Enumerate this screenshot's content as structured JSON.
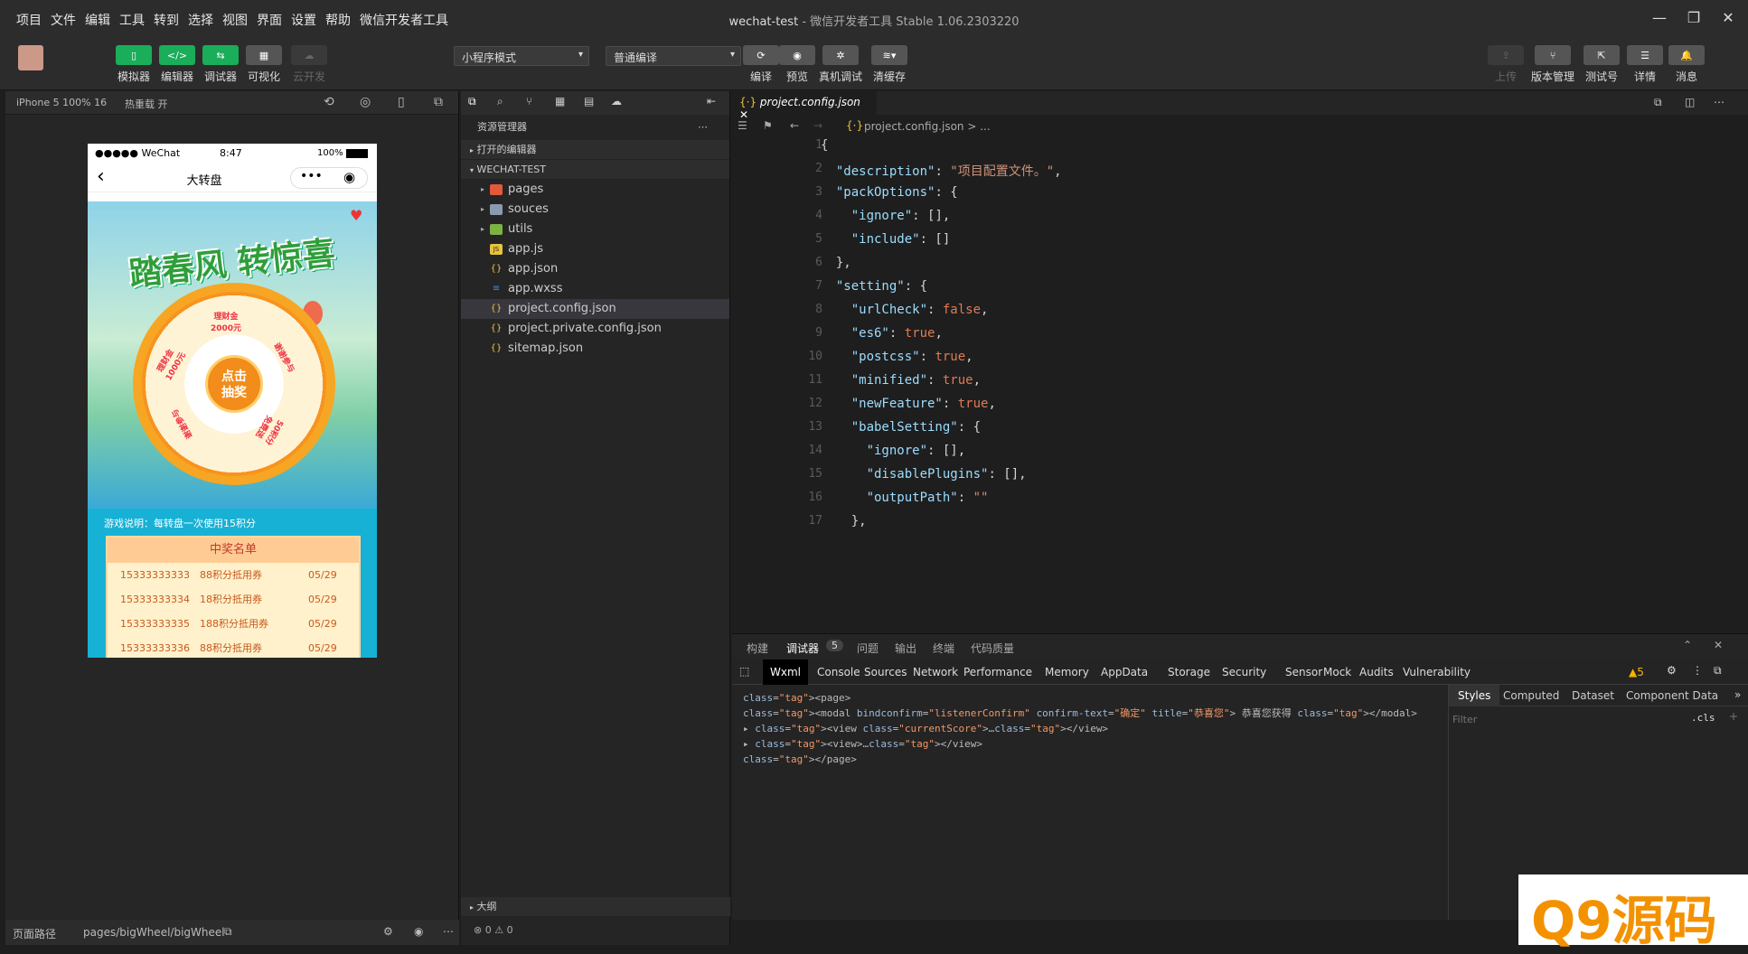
{
  "menubar": {
    "items": [
      "项目",
      "文件",
      "编辑",
      "工具",
      "转到",
      "选择",
      "视图",
      "界面",
      "设置",
      "帮助",
      "微信开发者工具"
    ],
    "title_main": "wechat-test",
    "title_sub": " - 微信开发者工具 Stable 1.06.2303220"
  },
  "toolbar": {
    "simulator": "模拟器",
    "editor": "编辑器",
    "debugger": "调试器",
    "visual": "可视化",
    "cloud": "云开发",
    "mode_select": "小程序模式",
    "compile_select": "普通编译",
    "compile": "编译",
    "preview": "预览",
    "realdebug": "真机调试",
    "clearcache": "清缓存",
    "upload": "上传",
    "version": "版本管理",
    "testaccount": "测试号",
    "details": "详情",
    "messages": "消息"
  },
  "simulator": {
    "device": "iPhone 5 100% 16",
    "hotreload": "热重载 开",
    "statusbar_left": "●●●●● WeChat",
    "statusbar_time": "8:47",
    "statusbar_battery": "100%",
    "nav_title": "大转盘",
    "banner_title": "踏春风 转惊喜",
    "wheel_center": "点击\n抽奖",
    "segment_1": "理财金\n2000元",
    "segment_2": "谢谢参与",
    "segment_3": "50积分\n免费送",
    "segment_4": "谢谢参与",
    "segment_5": "理财金\n1000元",
    "rule_text": "游戏说明：每转盘一次使用15积分",
    "winners_title": "中奖名单",
    "winners": [
      {
        "phone": "15333333333",
        "prize": "88积分抵用券",
        "date": "05/29"
      },
      {
        "phone": "15333333334",
        "prize": "18积分抵用券",
        "date": "05/29"
      },
      {
        "phone": "15333333335",
        "prize": "188积分抵用券",
        "date": "05/29"
      },
      {
        "phone": "15333333336",
        "prize": "88积分抵用券",
        "date": "05/29"
      }
    ],
    "footer_path_label": "页面路径",
    "footer_path": "pages/bigWheel/bigWheel"
  },
  "explorer": {
    "title": "资源管理器",
    "open_editors": "打开的编辑器",
    "project": "WECHAT-TEST",
    "files": [
      {
        "name": "pages",
        "type": "folder",
        "color": "#e2593b"
      },
      {
        "name": "souces",
        "type": "folder",
        "color": "#8a9bb0"
      },
      {
        "name": "utils",
        "type": "folder",
        "color": "#7cb342"
      },
      {
        "name": "app.js",
        "type": "js",
        "color": "#e8c33b"
      },
      {
        "name": "app.json",
        "type": "json",
        "color": "#e8c33b"
      },
      {
        "name": "app.wxss",
        "type": "wxss",
        "color": "#3b8fe8"
      },
      {
        "name": "project.config.json",
        "type": "json",
        "color": "#e8c33b"
      },
      {
        "name": "project.private.config.json",
        "type": "json",
        "color": "#e8c33b"
      },
      {
        "name": "sitemap.json",
        "type": "json",
        "color": "#e8c33b"
      }
    ],
    "outline": "大纲",
    "status": "⊗ 0 ⚠ 0"
  },
  "editor": {
    "tab": "project.config.json",
    "breadcrumb": "project.config.json > ...",
    "lines": [
      "{",
      "  \"description\": \"项目配置文件。\",",
      "  \"packOptions\": {",
      "    \"ignore\": [],",
      "    \"include\": []",
      "  },",
      "  \"setting\": {",
      "    \"urlCheck\": false,",
      "    \"es6\": true,",
      "    \"postcss\": true,",
      "    \"minified\": true,",
      "    \"newFeature\": true,",
      "    \"babelSetting\": {",
      "      \"ignore\": [],",
      "      \"disablePlugins\": [],",
      "      \"outputPath\": \"\"",
      "    },"
    ]
  },
  "devtools": {
    "top_tabs": [
      "构建",
      "调试器",
      "问题",
      "输出",
      "终端",
      "代码质量"
    ],
    "debugger_badge": "5",
    "panel_tabs": [
      "Wxml",
      "Console",
      "Sources",
      "Network",
      "Performance",
      "Memory",
      "AppData",
      "Storage",
      "Security",
      "Sensor",
      "Mock",
      "Audits",
      "Vulnerability"
    ],
    "warn_count": "▲5",
    "wxml_lines": [
      "<page>",
      "  <modal bindconfirm=\"listenerConfirm\" confirm-text=\"确定\" title=\"恭喜您\"> 恭喜您获得 </modal>",
      "▸ <view class=\"currentScore\">…</view>",
      "▸ <view>…</view>",
      "</page>"
    ],
    "style_tabs": [
      "Styles",
      "Computed",
      "Dataset",
      "Component Data"
    ],
    "filter_placeholder": "Filter",
    "cls": ".cls"
  },
  "watermark": "Q9源码"
}
